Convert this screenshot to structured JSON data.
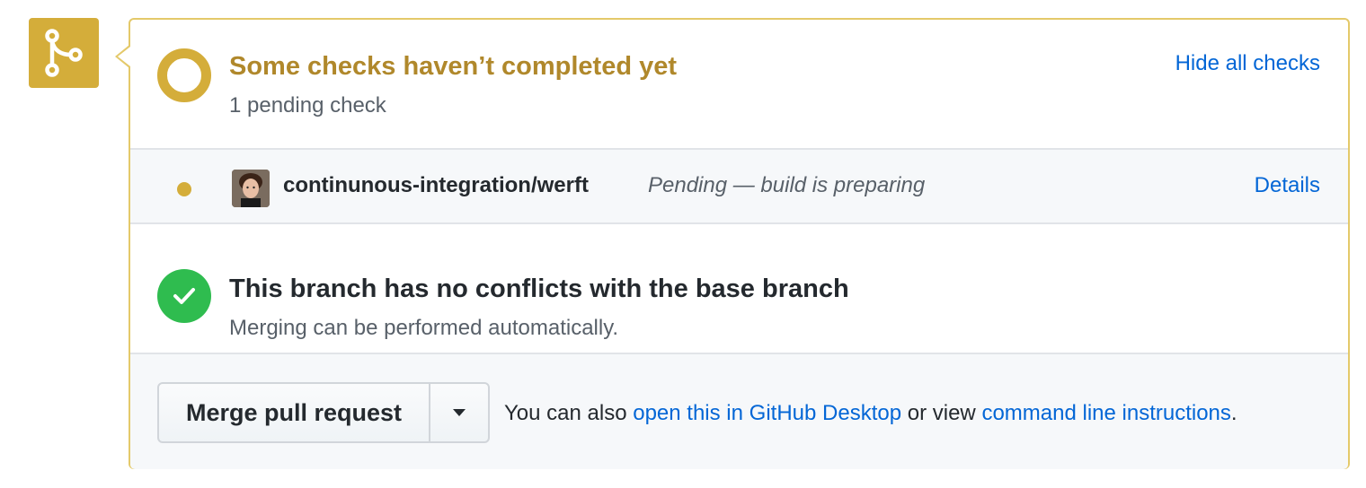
{
  "status": {
    "title": "Some checks haven’t completed yet",
    "subtitle": "1 pending check",
    "toggle_link": "Hide all checks"
  },
  "checks": [
    {
      "name": "continunous-integration/werft",
      "description": "Pending — build is preparing",
      "details_link": "Details"
    }
  ],
  "conflicts": {
    "title": "This branch has no conflicts with the base branch",
    "subtitle": "Merging can be performed automatically."
  },
  "merge": {
    "button_label": "Merge pull request",
    "text_prefix": "You can also",
    "desktop_link": "open this in GitHub Desktop",
    "text_middle": "or view",
    "cli_link": "command line instructions",
    "text_suffix": "."
  },
  "colors": {
    "pending": "#d4ad3a",
    "pending_text": "#b0882b",
    "success": "#2fbc4f",
    "link": "#0366d6"
  },
  "icons": {
    "merge": "git-merge-icon",
    "pending": "pending-ring-icon",
    "check_status": "pending-dot-icon",
    "success": "check-circle-icon",
    "dropdown": "caret-down-icon"
  }
}
